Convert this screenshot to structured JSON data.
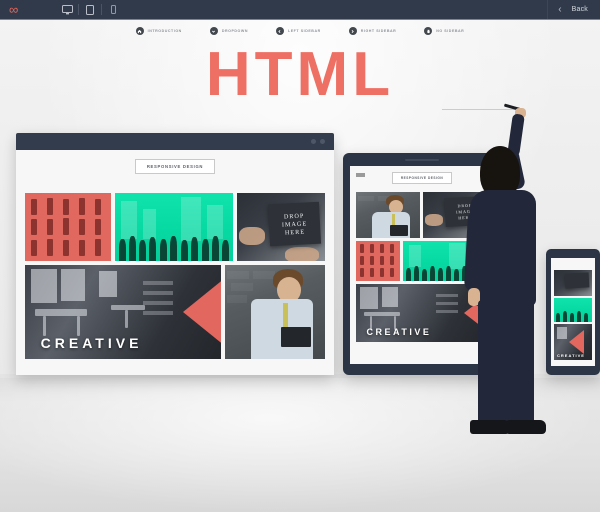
{
  "toolbar": {
    "logo_icon": "infinity-logo-icon",
    "devices": [
      {
        "name": "desktop-view-icon",
        "label": "Desktop"
      },
      {
        "name": "tablet-view-icon",
        "label": "Tablet"
      },
      {
        "name": "mobile-view-icon",
        "label": "Mobile"
      }
    ],
    "back_icon": "chevron-left-icon",
    "back_label": "Back"
  },
  "nav": {
    "items": [
      {
        "label": "INTRODUCTION",
        "icon": "home-icon"
      },
      {
        "label": "DROPDOWN",
        "icon": "chevron-down-circle-icon"
      },
      {
        "label": "LEFT SIDEBAR",
        "icon": "chevron-left-circle-icon"
      },
      {
        "label": "RIGHT SIDEBAR",
        "icon": "chevron-right-circle-icon"
      },
      {
        "label": "NO SIDEBAR",
        "icon": "circle-icon"
      }
    ]
  },
  "hero": {
    "word": "HTML",
    "color": "#ee6f63"
  },
  "browser": {
    "window_controls": [
      "minimize-dot",
      "close-dot"
    ],
    "responsive_button": "RESPONSIVE DESIGN",
    "tiles": {
      "red_people": "red people silhouettes",
      "teal_crowd": "teal crowd silhouettes",
      "drop_image": [
        "DROP",
        "IMAGE",
        "HERE"
      ],
      "creative": "CREATIVE",
      "man_reading": "man reading book"
    }
  },
  "tablet": {
    "responsive_button": "RESPONSIVE DESIGN",
    "creative_label": "CREATIVE",
    "drop_image": [
      "DROP",
      "IMAGE",
      "HERE"
    ]
  },
  "phone": {
    "creative_label": "CREATIVE"
  },
  "scene": {
    "person": "person-in-suit-writing",
    "pen": "marker-pen",
    "wall_color": "#eeeeee",
    "floor_color": "#e0e0e0",
    "dark_ui_color": "#303a4b",
    "accent_color": "#e2675f",
    "teal_color": "#07d9a3"
  }
}
